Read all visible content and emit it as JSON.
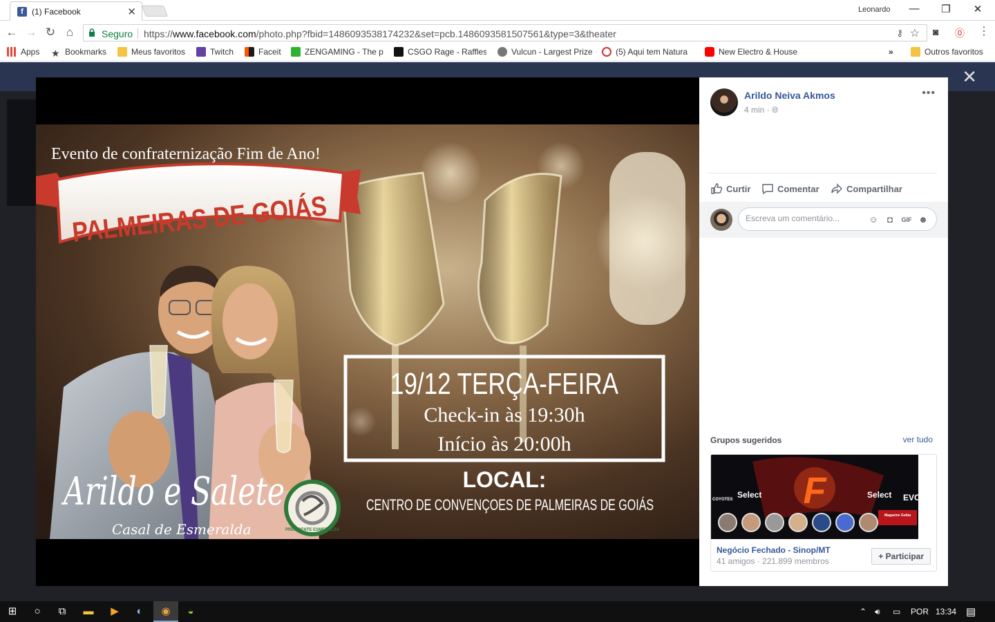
{
  "browser": {
    "tab_title": "(1) Facebook",
    "profile_name": "Leonardo",
    "secure_label": "Seguro",
    "url_prefix": "https://",
    "url_host": "www.facebook.com",
    "url_path": "/photo.php?fbid=1486093538174232&set=pcb.1486093581507561&type=3&theater"
  },
  "bookmarks": [
    {
      "label": "Apps",
      "icon": "apps-grid-icon",
      "color": "#e04a3f"
    },
    {
      "label": "Bookmarks",
      "icon": "star-icon",
      "color": "#444444"
    },
    {
      "label": "Meus favoritos",
      "icon": "folder-icon",
      "color": "#f5c342"
    },
    {
      "label": "Twitch",
      "icon": "twitch-icon",
      "color": "#6441a5"
    },
    {
      "label": "Faceit",
      "icon": "faceit-icon",
      "color": "#ff5500"
    },
    {
      "label": "ZENGAMING - The p",
      "icon": "zengaming-icon",
      "color": "#2fb22f"
    },
    {
      "label": "CSGO Rage - Raffles",
      "icon": "csgo-rage-icon",
      "color": "#111111"
    },
    {
      "label": "Vulcun - Largest Prize",
      "icon": "vulcun-icon",
      "color": "#555555"
    },
    {
      "label": "(5) Aqui tem Natura",
      "icon": "natura-icon",
      "color": "#d0312d"
    },
    {
      "label": "New Electro & House",
      "icon": "youtube-icon",
      "color": "#ff0000"
    }
  ],
  "bookmarks_overflow": "»",
  "other_favorites": "Outros favoritos",
  "post": {
    "author": "Arildo Neiva Akmos",
    "time": "4 min",
    "more": "•••",
    "actions": {
      "like": "Curtir",
      "comment": "Comentar",
      "share": "Compartilhar"
    },
    "comment_placeholder": "Escreva um comentário..."
  },
  "photo": {
    "headline": "Evento de confraternização Fim de Ano!",
    "banner_text": "PALMEIRAS DE GOIÁS",
    "date": "19/12 TERÇA-FEIRA",
    "checkin": "Check-in às 19:30h",
    "start": "Início às 20:00h",
    "local_label": "LOCAL:",
    "venue": "CENTRO DE CONVENÇOES DE PALMEIRAS DE GOIÁS",
    "signature": "Arildo e Salete",
    "couple": "Casal de Esmeralda",
    "seal_text": "PRESIDENTE ESMERALDA"
  },
  "suggested_groups": {
    "title": "Grupos sugeridos",
    "see_all": "ver tudo",
    "group": {
      "name": "Negócio Fechado - Sinop/MT",
      "stats": "41 amigos · 221.899 membros",
      "join": "Participar",
      "banner_texts": {
        "left_logo": "Select",
        "right_logo": "Select",
        "evo": "EVO",
        "coyotes": "COYOTES",
        "center": "F",
        "badge": "Magazine Gobia"
      }
    }
  },
  "taskbar": {
    "language": "POR",
    "time": "13:34"
  }
}
